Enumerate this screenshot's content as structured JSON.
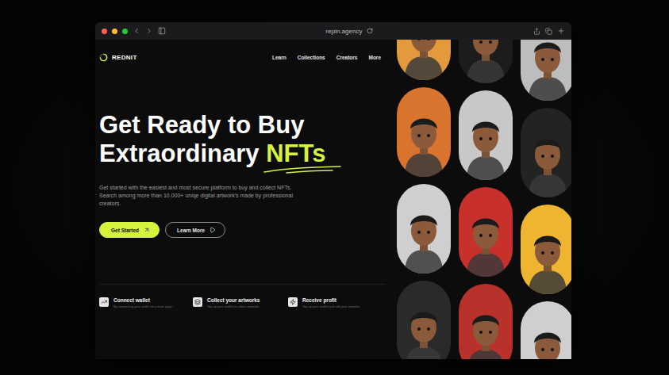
{
  "browser": {
    "url": "repin.agency"
  },
  "logo": {
    "name": "REDNIT"
  },
  "nav": [
    {
      "label": "Learn"
    },
    {
      "label": "Collections"
    },
    {
      "label": "Creators"
    },
    {
      "label": "More"
    }
  ],
  "hero": {
    "title_line1": "Get Ready to Buy",
    "title_line2": "Extraordinary",
    "title_highlight": "NFTs",
    "description": "Get started with the easiest and most secure platform to buy and collect NFTs. Search among more than 10.000+ uniqe digital artwork's made by professional creators."
  },
  "buttons": [
    {
      "label": "Get Started",
      "kind": "primary"
    },
    {
      "label": "Learn More",
      "kind": "secondary"
    }
  ],
  "features": [
    {
      "title": "Connect wallet",
      "subtitle": "By connecting your wallet on a main page"
    },
    {
      "title": "Collect your artworks",
      "subtitle": "Top up your wallet to collect artworks"
    },
    {
      "title": "Receive profit",
      "subtitle": "Top up your wallet and sell your artworks"
    }
  ],
  "gallery": [
    [
      {
        "color": "#e39a3c"
      },
      {
        "color": "#d9742f"
      },
      {
        "color": "#cfcfcf"
      },
      {
        "color": "#2a2a2a"
      }
    ],
    [
      {
        "color": "#1c1c1c"
      },
      {
        "color": "#c8c8c8"
      },
      {
        "color": "#c7302b"
      },
      {
        "color": "#b8312a"
      }
    ],
    [
      {
        "color": "#bdbdbd"
      },
      {
        "color": "#232323"
      },
      {
        "color": "#f0b530"
      },
      {
        "color": "#cfcfcf"
      }
    ]
  ]
}
